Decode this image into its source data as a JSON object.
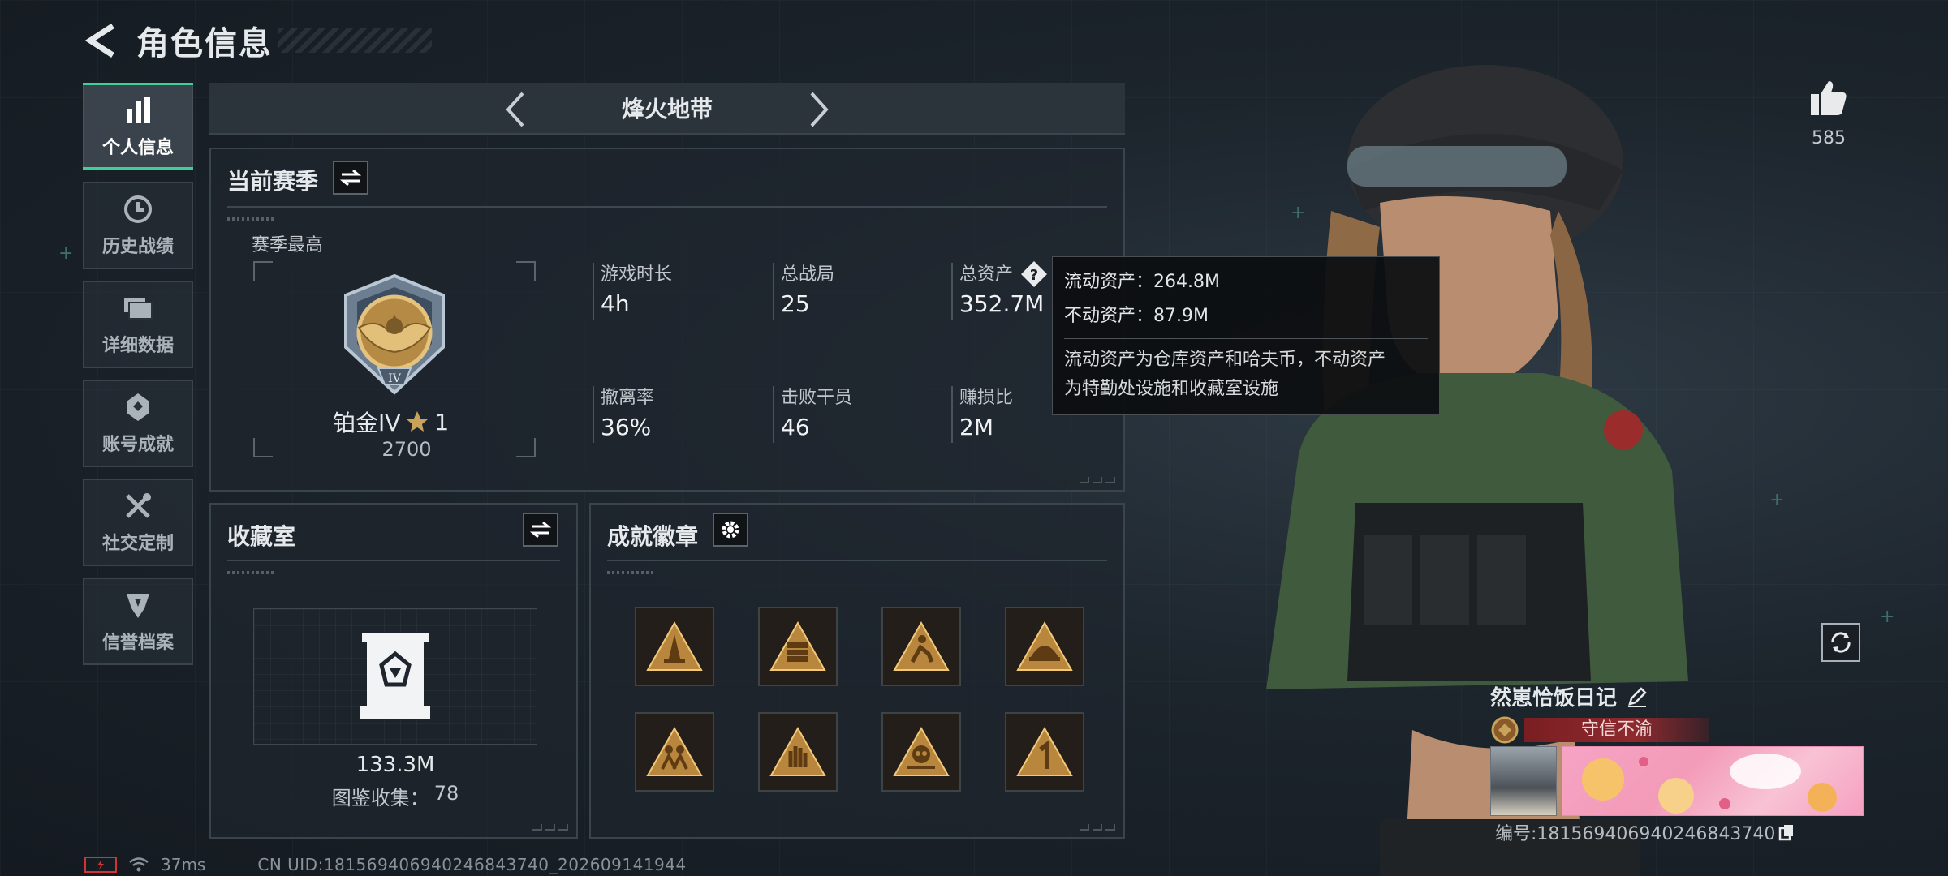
{
  "header": {
    "title": "角色信息"
  },
  "sidebar": {
    "items": [
      {
        "label": "个人信息",
        "icon": "bar-chart-icon",
        "active": true
      },
      {
        "label": "历史战绩",
        "icon": "history-clock-icon",
        "active": false
      },
      {
        "label": "详细数据",
        "icon": "folder-stack-icon",
        "active": false
      },
      {
        "label": "账号成就",
        "icon": "achievement-badge-icon",
        "active": false
      },
      {
        "label": "社交定制",
        "icon": "wrench-screwdriver-icon",
        "active": false
      },
      {
        "label": "信誉档案",
        "icon": "credit-shield-icon",
        "active": false
      }
    ]
  },
  "mode": {
    "title": "烽火地带"
  },
  "season": {
    "title": "当前赛季",
    "best_label": "赛季最高",
    "rank_name": "铂金IV",
    "rank_stars": "1",
    "rank_score": "2700",
    "stats": [
      {
        "label": "游戏时长",
        "value": "4h"
      },
      {
        "label": "总战局",
        "value": "25"
      },
      {
        "label": "总资产",
        "value": "352.7M"
      },
      {
        "label": "撤离率",
        "value": "36%"
      },
      {
        "label": "击败干员",
        "value": "46"
      },
      {
        "label": "赚损比",
        "value": "2M"
      }
    ]
  },
  "tooltip": {
    "liquid": "流动资产：264.8M",
    "fixed": "不动资产：87.9M",
    "desc_line1": "流动资产为仓库资产和哈夫币，不动资产",
    "desc_line2": "为特勤处设施和收藏室设施"
  },
  "collection": {
    "title": "收藏室",
    "value": "133.3M",
    "count_label": "图鉴收集：",
    "count_value": "78"
  },
  "badges": {
    "title": "成就徽章",
    "count": 8
  },
  "likes": {
    "count": "585"
  },
  "profile": {
    "name": "然崽恰饭日记",
    "credit": "守信不渝",
    "id_text": "编号:181569406940246843740"
  },
  "status": {
    "ping": "37ms",
    "uid": "CN UID:181569406940246843740_202609141944"
  },
  "colors": {
    "accent": "#3fcf9b",
    "credit_red": "#8e2a2e",
    "gold": "#c9a35a"
  }
}
